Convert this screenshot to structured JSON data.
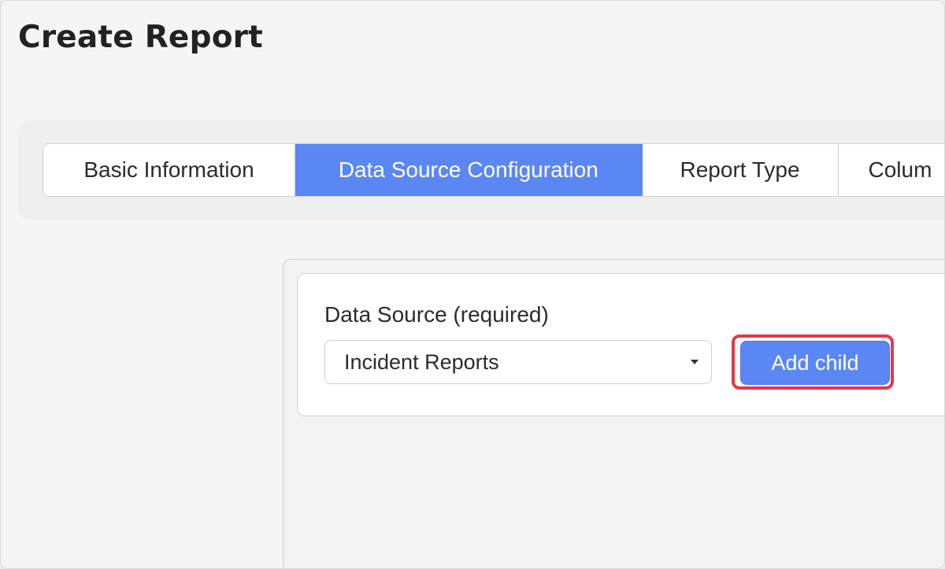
{
  "page": {
    "title": "Create Report"
  },
  "tabs": [
    {
      "label": "Basic Information",
      "active": false
    },
    {
      "label": "Data Source Configuration",
      "active": true
    },
    {
      "label": "Report Type",
      "active": false
    },
    {
      "label": "Colum",
      "active": false
    }
  ],
  "data_source": {
    "label": "Data Source (required)",
    "selected_value": "Incident Reports",
    "add_child_label": "Add child"
  },
  "colors": {
    "accent": "#5b87f5",
    "highlight": "#e8364a",
    "background": "#f5f5f5"
  },
  "icons": {
    "select_caret": "caret-down-icon"
  }
}
